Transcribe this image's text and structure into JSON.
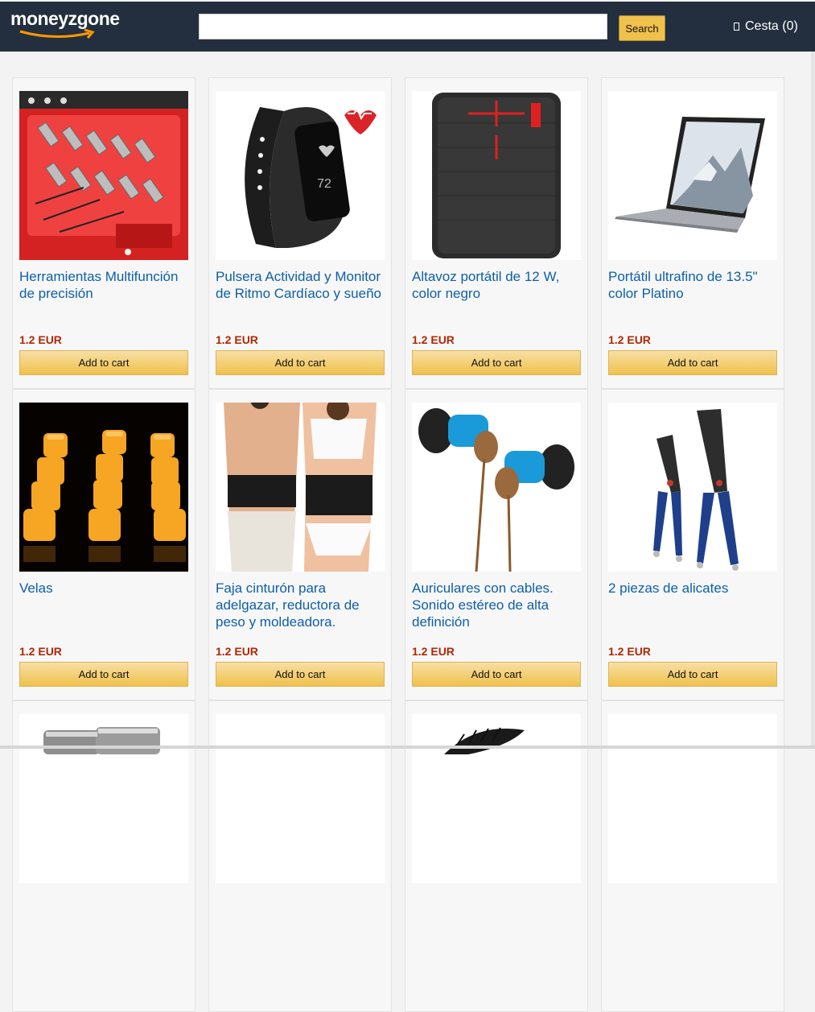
{
  "header": {
    "brand": "moneyzgone",
    "search": {
      "value": "",
      "placeholder": "",
      "button_label": "Search"
    },
    "cart_label": "Cesta (0)",
    "colors": {
      "bar": "#232f3e",
      "button": "#f0c14b"
    }
  },
  "products": [
    {
      "title": "Herramientas Multifunción de precisión",
      "price": "1.2 EUR",
      "button": "Add to cart",
      "image": "precision-screwdriver-set"
    },
    {
      "title": "Pulsera Actividad y Monitor de Ritmo Cardíaco y sueño",
      "price": "1.2 EUR",
      "button": "Add to cart",
      "image": "fitness-band",
      "display_number": "72"
    },
    {
      "title": "Altavoz portátil de 12 W, color negro",
      "price": "1.2 EUR",
      "button": "Add to cart",
      "image": "portable-speaker"
    },
    {
      "title": "Portátil ultrafino de 13.5\" color Platino",
      "price": "1.2 EUR",
      "button": "Add to cart",
      "image": "laptop"
    },
    {
      "title": "Velas",
      "price": "1.2 EUR",
      "button": "Add to cart",
      "image": "led-candles"
    },
    {
      "title": "Faja cinturón para adelgazar, reductora de peso y moldeadora.",
      "price": "1.2 EUR",
      "button": "Add to cart",
      "image": "waist-trimmer-belt"
    },
    {
      "title": "Auriculares con cables. Sonido estéreo de alta definición",
      "price": "1.2 EUR",
      "button": "Add to cart",
      "image": "wired-earphones"
    },
    {
      "title": "2 piezas de alicates",
      "price": "1.2 EUR",
      "button": "Add to cart",
      "image": "pliers"
    },
    {
      "title": "",
      "price": "",
      "button": "",
      "image": "cups"
    },
    {
      "title": "",
      "price": "",
      "button": "",
      "image": "blank"
    },
    {
      "title": "",
      "price": "",
      "button": "",
      "image": "brush"
    },
    {
      "title": "",
      "price": "",
      "button": "",
      "image": "blank"
    }
  ]
}
